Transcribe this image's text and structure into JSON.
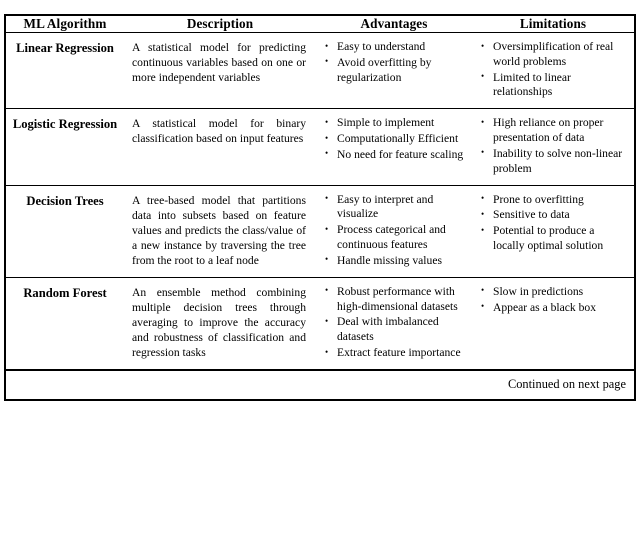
{
  "table": {
    "columns": [
      {
        "key": "algorithm",
        "label": "ML Algorithm"
      },
      {
        "key": "description",
        "label": "Description"
      },
      {
        "key": "advantages",
        "label": "Advantages"
      },
      {
        "key": "limitations",
        "label": "Limitations"
      }
    ],
    "rows": [
      {
        "algorithm": "Linear Regression",
        "description": "A statistical model for predicting continuous variables based on one or more independent variables",
        "advantages": [
          "Easy to understand",
          "Avoid overfitting by regularization"
        ],
        "limitations": [
          "Oversimplification of real world problems",
          "Limited to linear relationships"
        ]
      },
      {
        "algorithm": "Logistic Regression",
        "description": "A statistical model for binary classification based on input features",
        "advantages": [
          "Simple to implement",
          "Computationally Efficient",
          "No need for feature scaling"
        ],
        "limitations": [
          "High reliance on proper presentation of data",
          "Inability to solve non-linear problem"
        ]
      },
      {
        "algorithm": "Decision Trees",
        "description": "A tree-based model that partitions data into subsets based on feature values and predicts the class/value of a new instance by traversing the tree from the root to a leaf node",
        "advantages": [
          "Easy to interpret and visualize",
          "Process categorical and continuous features",
          "Handle missing values"
        ],
        "limitations": [
          "Prone to overfitting",
          "Sensitive to data",
          "Potential to produce a locally optimal solution"
        ]
      },
      {
        "algorithm": "Random Forest",
        "description": "An ensemble method combining multiple decision trees through averaging to improve the accuracy and robustness of classification and regression tasks",
        "advantages": [
          "Robust performance with high-dimensional datasets",
          "Deal with imbalanced datasets",
          "Extract feature importance"
        ],
        "limitations": [
          "Slow in predictions",
          "Appear as a black box"
        ]
      }
    ],
    "footer": "Continued on next page"
  }
}
